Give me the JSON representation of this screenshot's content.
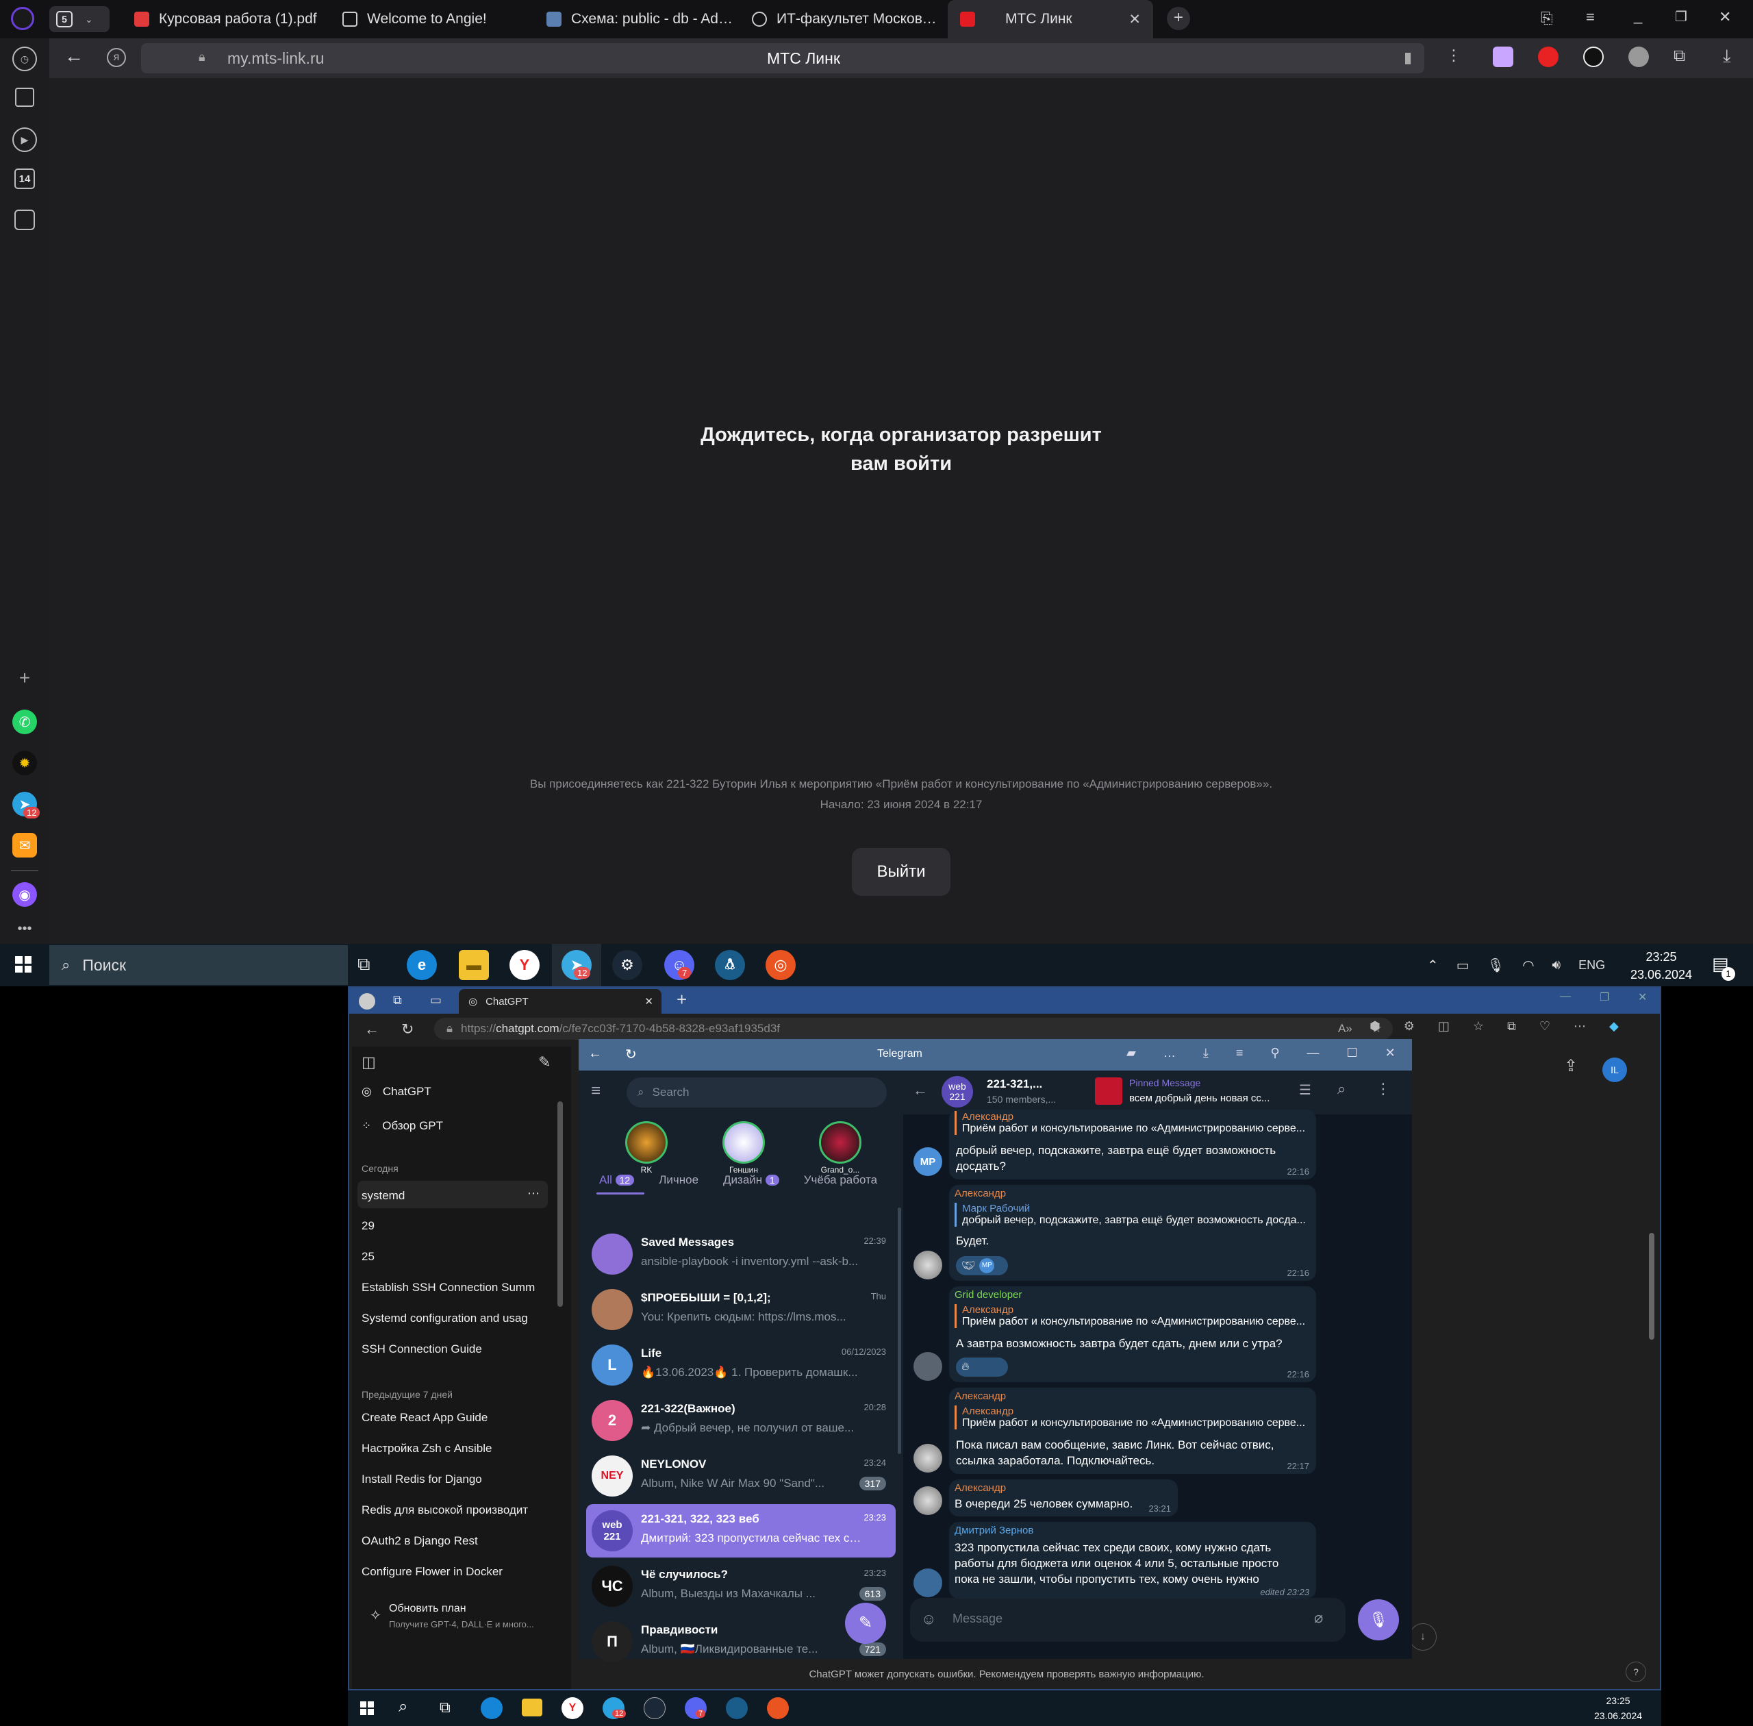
{
  "browser": {
    "tab_count": "5",
    "tabs": [
      {
        "label": "Курсовая работа (1).pdf"
      },
      {
        "label": "Welcome to Angie!"
      },
      {
        "label": "Схема: public - db - Admin"
      },
      {
        "label": "ИТ-факультет Московско"
      },
      {
        "label": "МТС Линк"
      }
    ],
    "url": "my.mts-link.ru",
    "page_title": "МТС Линк",
    "sidebar_badge": "14",
    "telegram_badge": "12"
  },
  "page": {
    "heading_line1": "Дождитесь, когда организатор разрешит",
    "heading_line2": "вам войти",
    "info_line1": "Вы присоединяетесь как 221-322 Буторин Илья к мероприятию «Приём работ и консультирование по «Администрированию серверов»».",
    "info_line2": "Начало: 23 июня 2024 в 22:17",
    "exit_button": "Выйти"
  },
  "taskbar_top": {
    "search": "Поиск",
    "lang": "ENG",
    "time": "23:25",
    "date": "23.06.2024",
    "telegram_badge": "12",
    "discord_badge": "7",
    "notif_badge": "1"
  },
  "edge": {
    "tab_label": "ChatGPT",
    "url_prefix": "https://",
    "url_host": "chatgpt.com",
    "url_path": "/c/fe7cc03f-7170-4b58-8328-e93af1935d3f",
    "avatar": "IL",
    "footer_note": "ChatGPT может допускать ошибки. Рекомендуем проверять важную информацию.",
    "help": "?"
  },
  "chatgpt": {
    "nav": [
      "ChatGPT",
      "Обзор GPT"
    ],
    "today_label": "Сегодня",
    "today": [
      "systemd",
      "29",
      "25",
      "Establish SSH Connection Summ",
      "Systemd configuration and usag",
      "SSH Connection Guide"
    ],
    "prev_label": "Предыдущие 7 дней",
    "prev": [
      "Create React App Guide",
      "Настройка Zsh с Ansible",
      "Install Redis for Django",
      "Redis для высокой производит",
      "OAuth2 в Django Rest",
      "Configure Flower in Docker"
    ],
    "upgrade_title": "Обновить план",
    "upgrade_sub": "Получите GPT-4, DALL·E и много..."
  },
  "telegram": {
    "title": "Telegram",
    "search_placeholder": "Search",
    "stories": [
      "RK",
      "Геншин",
      "Grand_o..."
    ],
    "folders": [
      {
        "label": "All",
        "badge": "12"
      },
      {
        "label": "Личное",
        "badge": ""
      },
      {
        "label": "Дизайн",
        "badge": "1"
      },
      {
        "label": "Учёба работа",
        "badge": ""
      }
    ],
    "chats": [
      {
        "name": "Saved Messages",
        "time": "22:39",
        "preview": "ansible-playbook -i inventory.yml --ask-b...",
        "avatar": "",
        "badge": "",
        "color": "#8e6fd8"
      },
      {
        "name": "$ПРОЕБЫШИ = [0,1,2];",
        "time": "Thu",
        "preview": "You: Крепить сюдым: https://lms.mos...",
        "avatar": "",
        "badge": "",
        "color": "#b07a5a"
      },
      {
        "name": "Life",
        "time": "06/12/2023",
        "preview": "🔥13.06.2023🔥 1. Проверить домашк...",
        "avatar": "L",
        "badge": "",
        "color": "#4a8fd8"
      },
      {
        "name": "221-322(Важное)",
        "time": "20:28",
        "preview": "➦ Добрый вечер, не получил от ваше...",
        "avatar": "2",
        "badge": "",
        "color": "#e05a8a"
      },
      {
        "name": "NEYLONOV",
        "time": "23:24",
        "preview": "Album, Nike W Air Max 90 \"Sand\"...",
        "avatar": "NEY",
        "badge": "317",
        "color": "#f2f2f2"
      },
      {
        "name": "221-321, 322, 323 веб",
        "time": "23:23",
        "preview": "Дмитрий: 323 пропустила сейчас тех сре...",
        "avatar": "web 221",
        "badge": "",
        "color": "#5b4bb8"
      },
      {
        "name": "Чё случилось?",
        "time": "23:23",
        "preview": "Album, Выезды из Махачкалы ...",
        "avatar": "ЧС",
        "badge": "613",
        "color": "#111"
      },
      {
        "name": "Правдивости",
        "time": "",
        "preview": "Album, 🇷🇺Ликвидированные те...",
        "avatar": "П",
        "badge": "721",
        "color": "#222"
      }
    ],
    "header_name": "221-321,...",
    "header_sub": "150 members,...",
    "header_avatar": "web 221",
    "pinned_label": "Pinned Message",
    "pinned_text": "всем добрый день новая сс...",
    "messages": [
      {
        "sender": "Александр",
        "quote_name": "",
        "quote": "Приём работ и консультирование по «Администрированию серве...",
        "text": "добрый вечер, подскажите, завтра ещё будет возможность досдать?",
        "time": "22:16",
        "avatar": "MP"
      },
      {
        "sender": "Александр",
        "quote_name": "Марк Рабочий",
        "quote": "добрый вечер, подскажите, завтра ещё будет возможность досда...",
        "text": "Будет.",
        "time": "22:16",
        "avatar": ""
      },
      {
        "sender": "Grid developer",
        "quote_name": "Александр",
        "quote": "Приём работ и консультирование по «Администрированию серве...",
        "text": "А завтра возможность завтра будет сдать, днем или с утра?",
        "time": "22:16",
        "avatar": ""
      },
      {
        "sender": "Александр",
        "quote_name": "Александр",
        "quote": "Приём работ и консультирование по «Администрированию серве...",
        "text": "Пока писал вам сообщение, завис Линк. Вот сейчас отвис, ссылка заработала. Подключайтесь.",
        "time": "22:17",
        "avatar": ""
      },
      {
        "sender": "Александр",
        "quote_name": "",
        "quote": "",
        "text": "В очереди 25 человек суммарно.",
        "time": "23:21",
        "avatar": ""
      },
      {
        "sender": "Дмитрий Зернов",
        "quote_name": "",
        "quote": "",
        "text": "323 пропустила сейчас тех среди своих, кому нужно сдать работы для бюджета или оценок 4 или 5, остальные просто пока не зашли, чтобы пропустить тех, кому очень нужно",
        "time": "edited 23:23",
        "avatar": ""
      }
    ],
    "reaction_mp": "MP",
    "composer_placeholder": "Message"
  },
  "taskbar_bottom": {
    "time": "23:25",
    "date": "23.06.2024",
    "telegram_badge": "12",
    "discord_badge": "7"
  },
  "colors": {
    "accent_purple": "#8774e1",
    "telegram_bg": "#0e1621",
    "mts_bg": "#1e1e21"
  }
}
